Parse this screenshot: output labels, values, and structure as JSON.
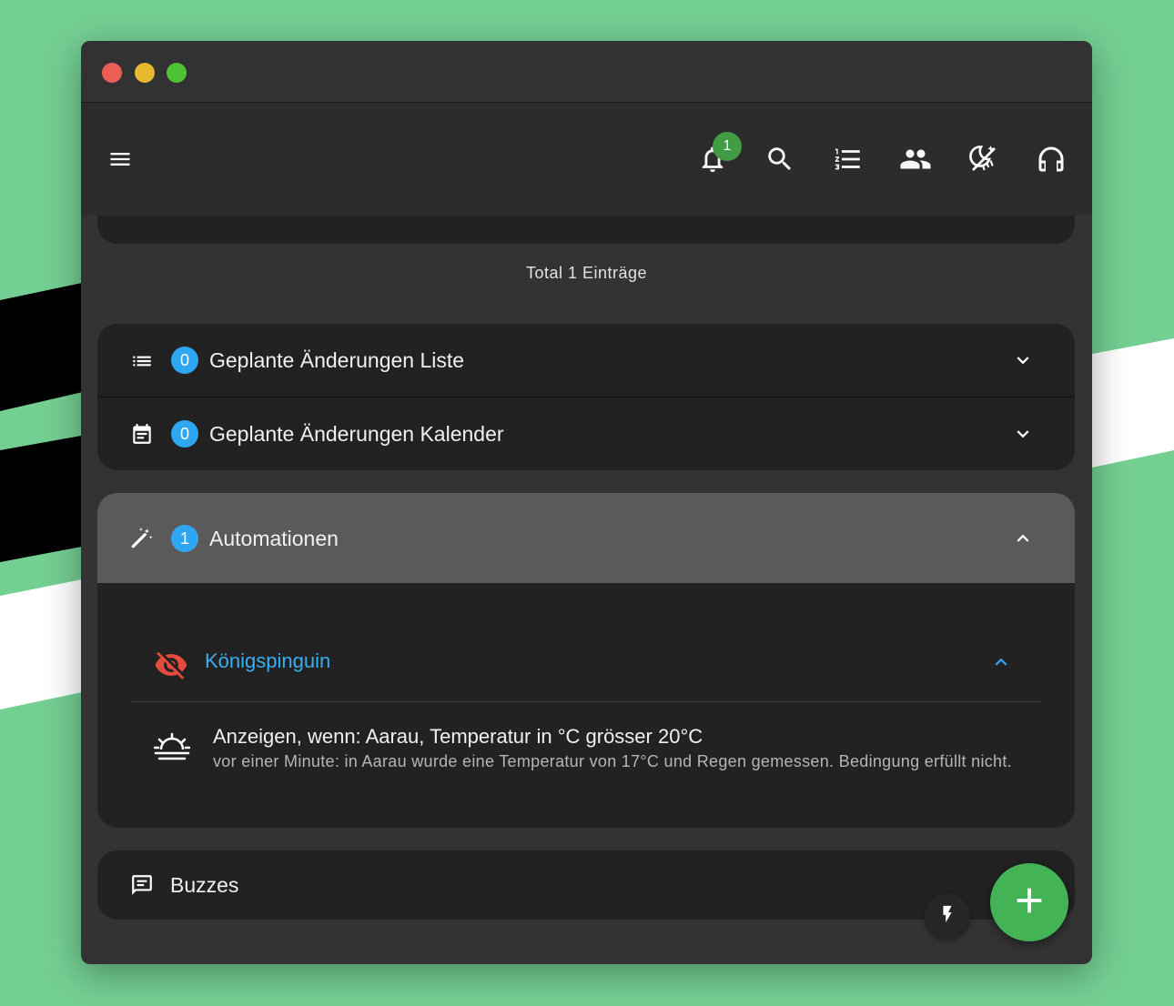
{
  "colors": {
    "background": "#74cf92",
    "window": "#333333",
    "panel": "#222222",
    "accent_blue": "#2ea7f2",
    "accent_green": "#43a047",
    "hidden_red": "#e54b3c"
  },
  "appbar": {
    "notification_count": "1",
    "icons": [
      "menu-icon",
      "bell-icon",
      "search-icon",
      "list-numbered-icon",
      "people-icon",
      "weather-icon",
      "headset-icon"
    ]
  },
  "summary": {
    "total": "Total 1 Einträge"
  },
  "sections": {
    "planned_list": {
      "count": "0",
      "label": "Geplante Änderungen Liste"
    },
    "planned_calendar": {
      "count": "0",
      "label": "Geplante Änderungen Kalender"
    },
    "automations": {
      "count": "1",
      "label": "Automationen"
    },
    "buzzes": {
      "label": "Buzzes"
    }
  },
  "automation": {
    "name": "Königspinguin",
    "condition_title": "Anzeigen, wenn: Aarau, Temperatur in °C grösser 20°C",
    "condition_detail": "vor einer Minute: in Aarau wurde eine Temperatur von 17°C und Regen gemessen. Bedingung erfüllt nicht."
  }
}
